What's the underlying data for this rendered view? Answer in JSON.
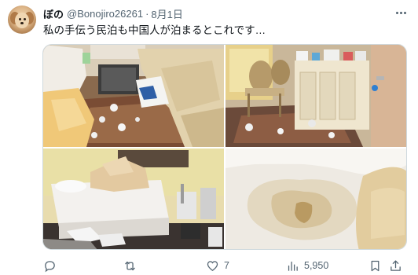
{
  "tweet": {
    "display_name": "ぼの",
    "handle": "@Bonojiro26261",
    "separator": "·",
    "date": "8月1日",
    "text": "私の手伝う民泊も中国人が泊まるとこれです…",
    "avatar_icon": "dog-avatar-icon",
    "more_icon": "more-horizontal-icon"
  },
  "media": {
    "photo_count": 4,
    "photos": [
      {
        "subject": "living room with beige leather sofa and scattered trash"
      },
      {
        "subject": "dining chairs, cabinet and littered rug"
      },
      {
        "subject": "bedroom with messy bed and clutter on floor"
      },
      {
        "subject": "stained white bed sheet"
      }
    ]
  },
  "actions": {
    "reply": {
      "icon": "reply-icon",
      "count": ""
    },
    "retweet": {
      "icon": "retweet-icon",
      "count": ""
    },
    "like": {
      "icon": "heart-icon",
      "count": "7"
    },
    "views": {
      "icon": "views-icon",
      "count": "5,950"
    },
    "bookmark": {
      "icon": "bookmark-icon"
    },
    "share": {
      "icon": "share-icon"
    }
  },
  "colors": {
    "text": "#0f1419",
    "secondary": "#536471",
    "border": "#cfd9de"
  }
}
